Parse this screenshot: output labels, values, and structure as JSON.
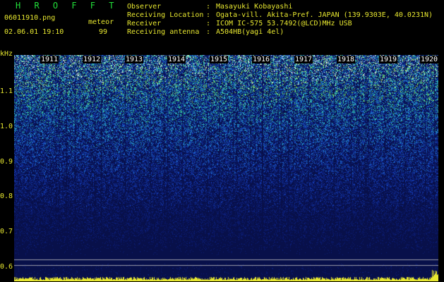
{
  "header": {
    "brand": "H R O F F T",
    "filename": "06011910.png",
    "datetime": "02.06.01 19:10",
    "meteor_label": "meteor",
    "meteor_count": "99"
  },
  "info": {
    "observer_key": "Observer",
    "observer_val": "Masayuki Kobayashi",
    "location_key": "Receiving Location",
    "location_val": "Ogata-vill. Akita-Pref. JAPAN (139.9303E, 40.0231N)",
    "receiver_key": "Receiver",
    "receiver_val": "ICOM IC-575 53.7492(@LCD)MHz USB",
    "antenna_key": "Receiving antenna",
    "antenna_val": "A504HB(yagi 4el)",
    "separator": ":"
  },
  "axis": {
    "unit": "kHz",
    "ticks": [
      "1.1",
      "1.0",
      "0.9",
      "0.8",
      "0.7",
      "0.6"
    ]
  },
  "minutes": [
    "1911",
    "1912",
    "1913",
    "1914",
    "1915",
    "1916",
    "1917",
    "1918",
    "1919",
    "1920"
  ],
  "colors": {
    "background": "#000000",
    "label": "#e8e830",
    "brand": "#22e03a",
    "spectrogram_base": "#08104a"
  }
}
